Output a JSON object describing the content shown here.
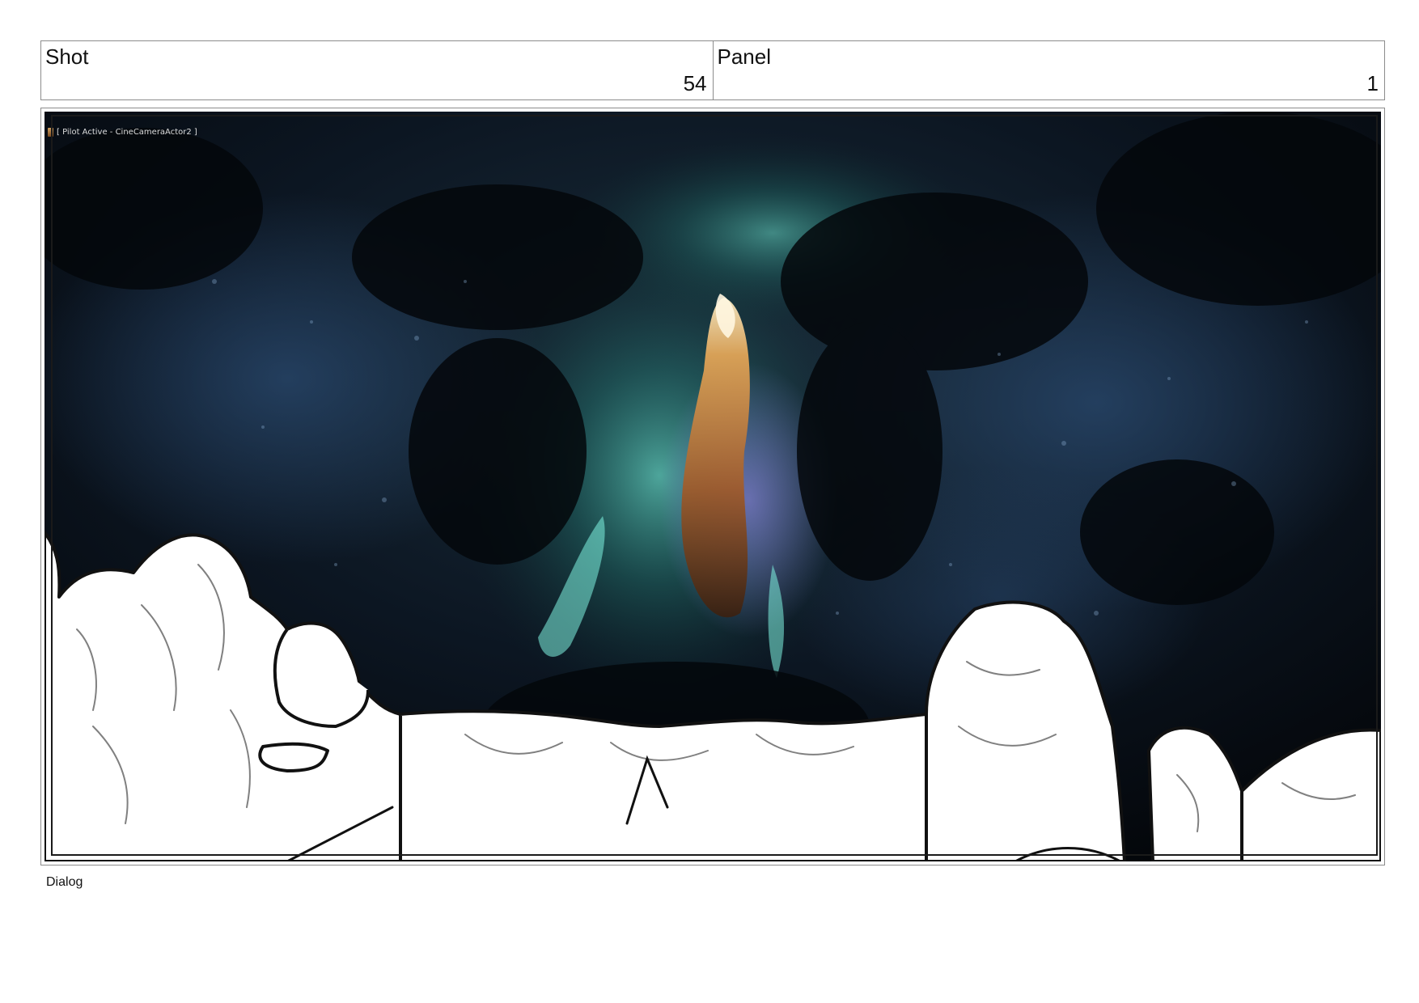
{
  "header": {
    "shot_label": "Shot",
    "shot_number": "54",
    "panel_label": "Panel",
    "panel_number": "1"
  },
  "panel": {
    "viewport_overlay": "[ Pilot Active - CineCameraActor2 ]",
    "viewport_icon": "camera-actor-icon",
    "colors": {
      "rock_dark": "#05080d",
      "rock_blue": "#1b2f4a",
      "teal_glow": "#5fe0c8",
      "amber_glow": "#d88a3a",
      "sketch_fill": "#ffffff",
      "sketch_line": "#111111"
    }
  },
  "footer": {
    "dialog_label": "Dialog"
  }
}
